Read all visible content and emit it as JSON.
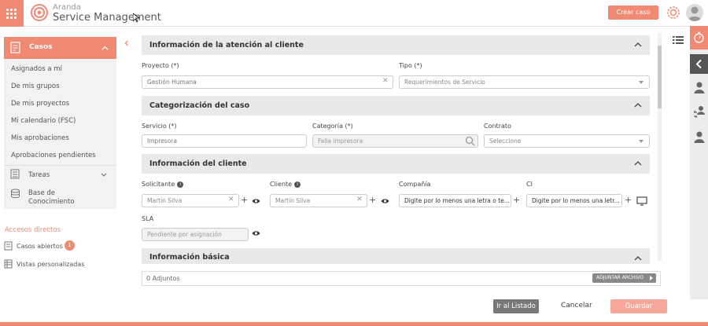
{
  "header": {
    "brand_top": "Aranda",
    "brand_bottom": "Service Management",
    "create_case": "Crear caso"
  },
  "sidebar": {
    "casos": "Casos",
    "items": [
      "Asignados a mí",
      "De mis grupos",
      "De mis proyectos",
      "Mi calendario (FSC)",
      "Mis aprobaciones",
      "Aprobaciones pendientes"
    ],
    "tareas": "Tareas",
    "kb_line1": "Base de",
    "kb_line2": "Conocimiento"
  },
  "shortcuts": {
    "title": "Accesos directos",
    "open_cases": "Casos abiertos",
    "open_cases_badge": "1",
    "custom_views": "Vistas personalizadas"
  },
  "sections": {
    "attention": "Información de la atención al cliente",
    "categorization": "Categorización del caso",
    "client": "Información del cliente",
    "basic": "Información básica"
  },
  "fields": {
    "proyecto_label": "Proyecto (*)",
    "proyecto_value": "Gestión Humana",
    "tipo_label": "Tipo (*)",
    "tipo_value": "Requerimientos de Servicio",
    "servicio_label": "Servicio (*)",
    "servicio_value": "Impresora",
    "categoria_label": "Categoría (*)",
    "categoria_value": "Falla impresora",
    "contrato_label": "Contrato",
    "contrato_value": "Seleccione",
    "solicitante_label": "Solicitante",
    "solicitante_value": "Martín Silva",
    "cliente_label": "Cliente",
    "cliente_value": "Martín Silva",
    "compania_label": "Compañía",
    "compania_placeholder": "Digite por lo menos una letra o te...",
    "ci_label": "CI",
    "ci_placeholder": "Digite por lo menos una letr...",
    "sla_label": "SLA",
    "sla_value": "Pendiente por asignación"
  },
  "attachments": {
    "count": "0 Adjuntos",
    "button": "ADJUNTAR ARCHIVO"
  },
  "footer": {
    "list": "Ir al Listado",
    "cancel": "Cancelar",
    "save": "Guardar"
  },
  "colors": {
    "accent": "#f08a73",
    "accent_light": "#f5a899",
    "section_bg": "#e9e9e9",
    "sidebar_bg": "#f2f2f2"
  }
}
